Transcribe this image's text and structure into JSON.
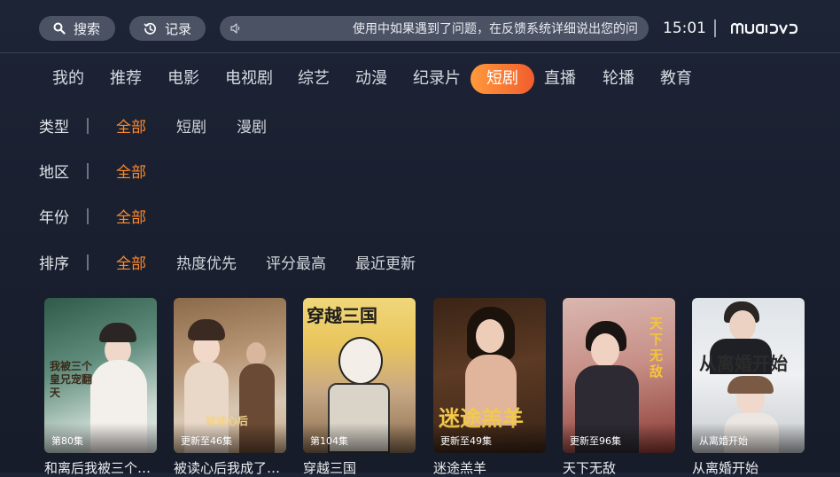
{
  "header": {
    "search_label": "搜索",
    "record_label": "记录",
    "notice_text": "使用中如果遇到了问题，在反馈系统详细说出您的问",
    "clock": "15:01",
    "logo": "MUQIDVD"
  },
  "tabs": [
    {
      "label": "我的"
    },
    {
      "label": "推荐"
    },
    {
      "label": "电影"
    },
    {
      "label": "电视剧"
    },
    {
      "label": "综艺"
    },
    {
      "label": "动漫"
    },
    {
      "label": "纪录片"
    },
    {
      "label": "短剧",
      "active": true
    },
    {
      "label": "直播"
    },
    {
      "label": "轮播"
    },
    {
      "label": "教育"
    }
  ],
  "filters": [
    {
      "label": "类型",
      "options": [
        "全部",
        "短剧",
        "漫剧"
      ]
    },
    {
      "label": "地区",
      "options": [
        "全部"
      ]
    },
    {
      "label": "年份",
      "options": [
        "全部"
      ]
    },
    {
      "label": "排序",
      "options": [
        "全部",
        "热度优先",
        "评分最高",
        "最近更新"
      ]
    }
  ],
  "cards": [
    {
      "title": "和离后我被三个…",
      "badge": "第80集",
      "poster_text": "我被三个皇兄宠翻天"
    },
    {
      "title": "被读心后我成了…",
      "badge": "更新至46集",
      "poster_text": "被读心后"
    },
    {
      "title": "穿越三国",
      "badge": "第104集",
      "poster_text": "穿越三国"
    },
    {
      "title": "迷途羔羊",
      "badge": "更新至49集",
      "poster_text": "迷途羔羊"
    },
    {
      "title": "天下无敌",
      "badge": "更新至96集",
      "poster_text": "天下无敌"
    },
    {
      "title": "从离婚开始",
      "badge": "从离婚开始",
      "poster_text": "从离婚开始"
    }
  ],
  "colors": {
    "accent": "#ff8a2b",
    "active_tab_start": "#ff9a3c",
    "active_tab_end": "#f25d2c",
    "background": "#1b2132"
  }
}
